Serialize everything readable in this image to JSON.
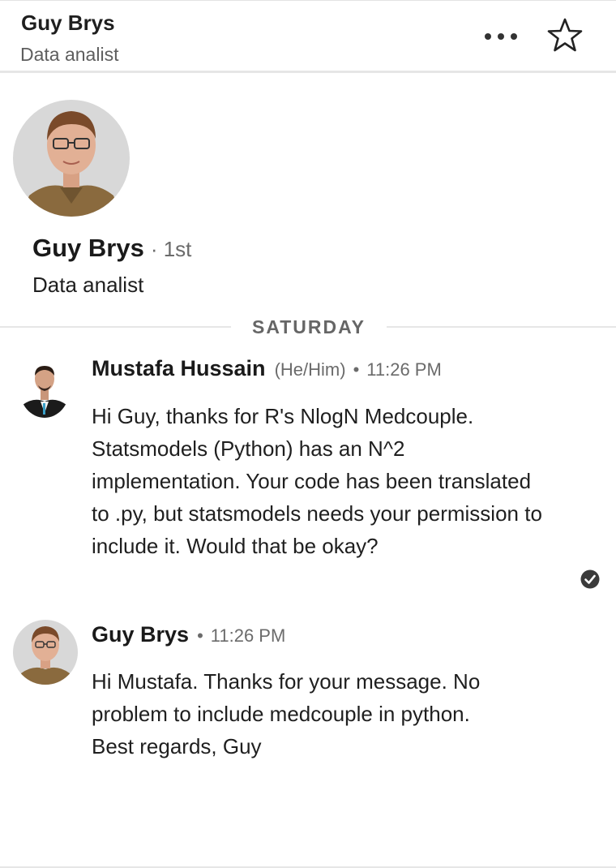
{
  "header": {
    "name": "Guy Brys",
    "subtitle": "Data analist",
    "more_icon": "more-horizontal-icon",
    "star_icon": "star-outline-icon"
  },
  "profile": {
    "name": "Guy Brys",
    "degree": "· 1st",
    "title": "Data analist"
  },
  "date_divider": "SATURDAY",
  "messages": [
    {
      "sender": "Mustafa Hussain",
      "pronouns": "(He/Him)",
      "separator": "•",
      "time": "11:26 PM",
      "body": "Hi Guy, thanks for R's NlogN Medcouple. Statsmodels (Python) has an N^2 implementation. Your code has been translated to .py, but statsmodels needs your permission to include it. Would that be okay?",
      "status_icon": "read-receipt-check-icon"
    },
    {
      "sender": "Guy Brys",
      "separator": "•",
      "time": "11:26 PM",
      "body": "Hi Mustafa. Thanks for your message. No problem to include medcouple in python. Best regards, Guy"
    }
  ],
  "colors": {
    "text_primary": "#1f1f1f",
    "text_secondary": "#6b6b6b",
    "divider": "#e6e6e6",
    "check": "#3a3a3a"
  }
}
